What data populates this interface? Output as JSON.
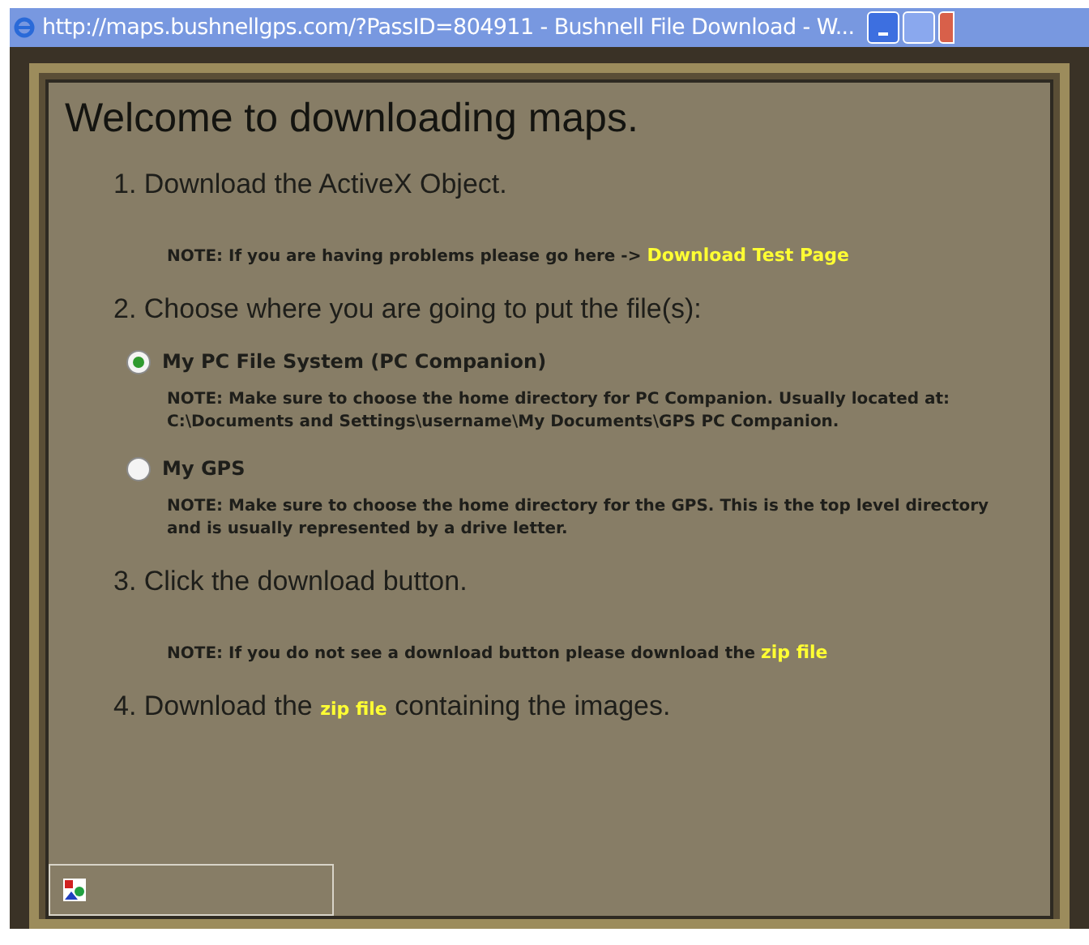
{
  "window": {
    "title": "http://maps.bushnellgps.com/?PassID=804911 - Bushnell File Download - W..."
  },
  "heading": "Welcome to downloading maps.",
  "items": [
    {
      "kind": "step",
      "text": "1. Download the ActiveX Object."
    },
    {
      "kind": "note",
      "text": "NOTE: If you are having problems please go here ->",
      "link": "Download Test Page"
    },
    {
      "kind": "step",
      "text": "2. Choose where you are going to put the file(s):"
    },
    {
      "kind": "radio",
      "text": "My PC File System (PC Companion)",
      "selected": true
    },
    {
      "kind": "note",
      "text": "NOTE: Make sure to choose the home directory for PC Companion. Usually located at: C:\\Documents and Settings\\username\\My Documents\\GPS PC Companion."
    },
    {
      "kind": "radio",
      "text": "My GPS",
      "selected": false
    },
    {
      "kind": "note",
      "text": "NOTE: Make sure to choose the home directory for the GPS. This is the top level directory and is usually represented by a drive letter."
    },
    {
      "kind": "step",
      "text": "3. Click the download button."
    },
    {
      "kind": "note",
      "text": "NOTE: If you do not see a download button please download the",
      "link": "zip file"
    },
    {
      "kind": "step",
      "text": "4. Download the",
      "link": "zip file",
      "after": "containing the images."
    }
  ]
}
